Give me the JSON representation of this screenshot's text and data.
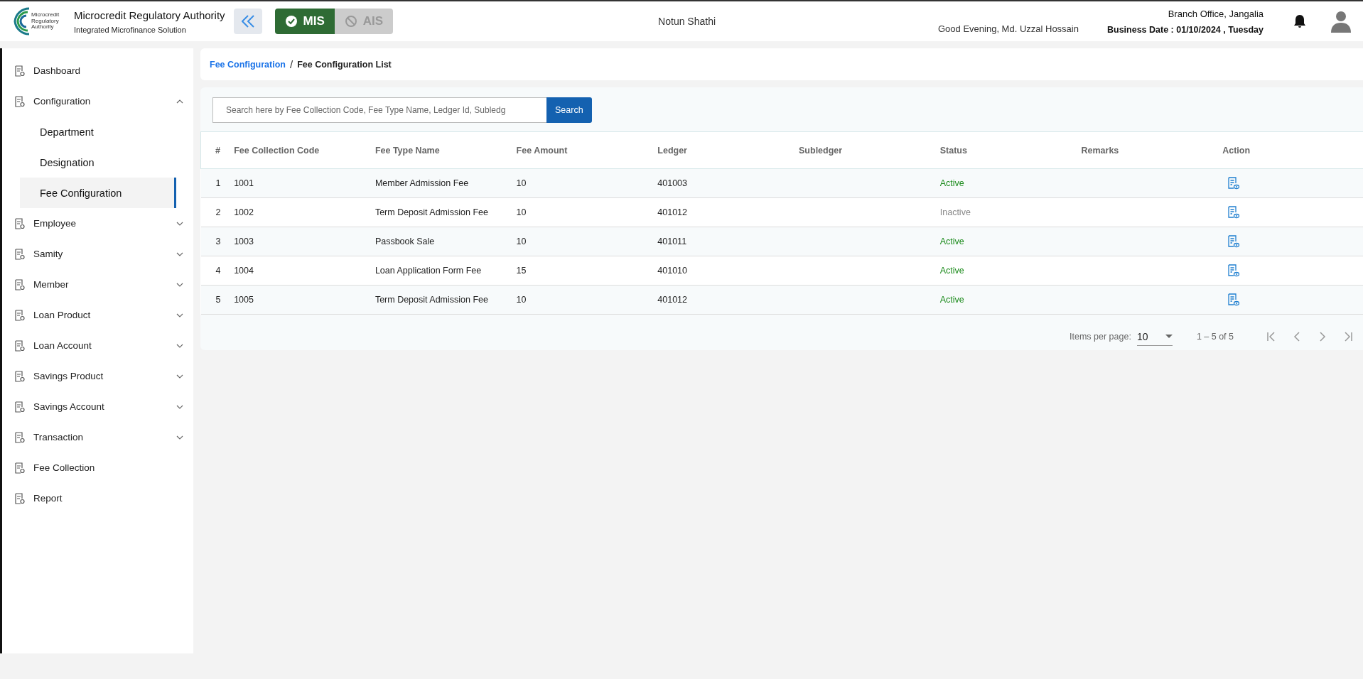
{
  "header": {
    "org_name": "Microcredit Regulatory Authority",
    "org_subtitle": "Integrated Microfinance Solution",
    "logo_text": "Microcredit Regulatory Authority",
    "modules": [
      {
        "label": "MIS",
        "selected": true
      },
      {
        "label": "AIS",
        "selected": false
      }
    ],
    "institution": "Notun Shathi",
    "greeting": "Good Evening, Md. Uzzal Hossain",
    "branch": "Branch Office, Jangalia",
    "business_date": "Business Date : 01/10/2024 , Tuesday"
  },
  "sidebar": {
    "items": [
      {
        "label": "Dashboard"
      },
      {
        "label": "Configuration",
        "expanded": true,
        "children": [
          {
            "label": "Department",
            "selected": false
          },
          {
            "label": "Designation",
            "selected": false
          },
          {
            "label": "Fee Configuration",
            "selected": true
          }
        ]
      },
      {
        "label": "Employee",
        "expanded": false
      },
      {
        "label": "Samity",
        "expanded": false
      },
      {
        "label": "Member",
        "expanded": false
      },
      {
        "label": "Loan Product",
        "expanded": false
      },
      {
        "label": "Loan Account",
        "expanded": false
      },
      {
        "label": "Savings Product",
        "expanded": false
      },
      {
        "label": "Savings Account",
        "expanded": false
      },
      {
        "label": "Transaction",
        "expanded": false
      },
      {
        "label": "Fee Collection"
      },
      {
        "label": "Report"
      }
    ]
  },
  "breadcrumb": [
    {
      "label": "Fee Configuration",
      "kind": "link"
    },
    {
      "label": "/",
      "kind": "separator"
    },
    {
      "label": "Fee Configuration List",
      "kind": "current"
    }
  ],
  "search": {
    "placeholder": "Search here by Fee Collection Code, Fee Type Name, Ledger Id, Subledg",
    "button": "Search"
  },
  "table": {
    "columns": [
      "#",
      "Fee Collection Code",
      "Fee Type Name",
      "Fee Amount",
      "Ledger",
      "Subledger",
      "Status",
      "Remarks",
      "Action"
    ],
    "rows": [
      {
        "index": "1",
        "code": "1001",
        "fee_type": "Member Admission Fee",
        "amount": "10",
        "ledger": "401003",
        "status": "Active",
        "active": true
      },
      {
        "index": "2",
        "code": "1002",
        "fee_type": "Term Deposit Admission Fee",
        "amount": "10",
        "ledger": "401012",
        "status": "Inactive",
        "active": false
      },
      {
        "index": "3",
        "code": "1003",
        "fee_type": "Passbook Sale",
        "amount": "10",
        "ledger": "401011",
        "status": "Active",
        "active": true
      },
      {
        "index": "4",
        "code": "1004",
        "fee_type": "Loan Application Form Fee",
        "amount": "15",
        "ledger": "401010",
        "status": "Active",
        "active": true
      },
      {
        "index": "5",
        "code": "1005",
        "fee_type": "Term Deposit Admission Fee",
        "amount": "10",
        "ledger": "401012",
        "status": "Active",
        "active": true
      }
    ]
  },
  "paginator": {
    "items_per_page_label": "Items per page:",
    "page_size": "10",
    "range": "1 – 5 of 5"
  }
}
